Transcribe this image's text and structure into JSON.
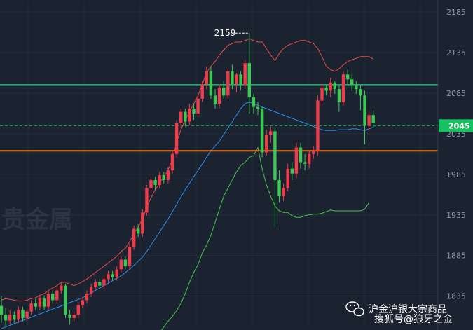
{
  "watermark": "贵金属",
  "wechat_account": "沪金沪银大宗商品",
  "sohu_account": "搜狐号@狼牙之金",
  "chart_data": {
    "type": "candlestick",
    "ylim": [
      1795,
      2198
    ],
    "yticks": [
      1835,
      1885,
      1935,
      1985,
      2035,
      2085,
      2135,
      2185
    ],
    "current_price": 2045,
    "current_price_label": "2045",
    "high_annotation": 2159,
    "high_annotation_label": "2159",
    "levels": [
      {
        "value": 2095,
        "color": "#4ee0a2"
      },
      {
        "value": 2014,
        "color": "#f07b1f"
      }
    ],
    "colors": {
      "up": "#ef3b4a",
      "down": "#3ec856",
      "mid": "#2b8ff0",
      "upper": "#e84a4a",
      "lower": "#4cc050",
      "tag": "#16c15f"
    },
    "candles": [
      [
        1823,
        1812,
        1835,
        1802
      ],
      [
        1812,
        1805,
        1820,
        1798
      ],
      [
        1805,
        1812,
        1818,
        1800
      ],
      [
        1812,
        1806,
        1816,
        1802
      ],
      [
        1806,
        1818,
        1822,
        1802
      ],
      [
        1818,
        1808,
        1822,
        1804
      ],
      [
        1808,
        1816,
        1820,
        1804
      ],
      [
        1816,
        1826,
        1830,
        1812
      ],
      [
        1826,
        1822,
        1832,
        1818
      ],
      [
        1822,
        1832,
        1836,
        1818
      ],
      [
        1832,
        1822,
        1836,
        1818
      ],
      [
        1822,
        1838,
        1842,
        1818
      ],
      [
        1838,
        1830,
        1842,
        1826
      ],
      [
        1830,
        1842,
        1846,
        1826
      ],
      [
        1842,
        1848,
        1852,
        1838
      ],
      [
        1848,
        1812,
        1850,
        1808
      ],
      [
        1812,
        1808,
        1818,
        1800
      ],
      [
        1808,
        1812,
        1816,
        1804
      ],
      [
        1812,
        1824,
        1828,
        1808
      ],
      [
        1824,
        1830,
        1834,
        1820
      ],
      [
        1830,
        1838,
        1842,
        1826
      ],
      [
        1838,
        1846,
        1850,
        1834
      ],
      [
        1846,
        1852,
        1856,
        1842
      ],
      [
        1852,
        1848,
        1856,
        1844
      ],
      [
        1848,
        1856,
        1860,
        1844
      ],
      [
        1856,
        1862,
        1866,
        1852
      ],
      [
        1862,
        1858,
        1866,
        1854
      ],
      [
        1858,
        1868,
        1872,
        1854
      ],
      [
        1868,
        1880,
        1884,
        1864
      ],
      [
        1880,
        1872,
        1884,
        1868
      ],
      [
        1872,
        1896,
        1900,
        1868
      ],
      [
        1896,
        1918,
        1922,
        1892
      ],
      [
        1918,
        1912,
        1924,
        1908
      ],
      [
        1912,
        1938,
        1942,
        1908
      ],
      [
        1938,
        1968,
        1972,
        1934
      ],
      [
        1968,
        1978,
        1982,
        1962
      ],
      [
        1978,
        1972,
        1982,
        1966
      ],
      [
        1972,
        1984,
        1988,
        1968
      ],
      [
        1984,
        1978,
        1988,
        1974
      ],
      [
        1978,
        1990,
        1994,
        1974
      ],
      [
        1990,
        2010,
        2015,
        1986
      ],
      [
        2010,
        2048,
        2052,
        2006
      ],
      [
        2048,
        2062,
        2066,
        2042
      ],
      [
        2062,
        2050,
        2066,
        2044
      ],
      [
        2050,
        2066,
        2072,
        2046
      ],
      [
        2066,
        2060,
        2072,
        2052
      ],
      [
        2060,
        2078,
        2082,
        2056
      ],
      [
        2078,
        2096,
        2100,
        2074
      ],
      [
        2096,
        2112,
        2118,
        2090
      ],
      [
        2112,
        2082,
        2118,
        2078
      ],
      [
        2082,
        2072,
        2090,
        2066
      ],
      [
        2072,
        2092,
        2096,
        2066
      ],
      [
        2092,
        2082,
        2100,
        2078
      ],
      [
        2082,
        2112,
        2116,
        2078
      ],
      [
        2112,
        2096,
        2120,
        2090
      ],
      [
        2096,
        2108,
        2110,
        2086
      ],
      [
        2108,
        2095,
        2112,
        2088
      ],
      [
        2095,
        2122,
        2126,
        2090
      ],
      [
        2122,
        2080,
        2159,
        2060
      ],
      [
        2080,
        2068,
        2084,
        2060
      ],
      [
        2068,
        2066,
        2074,
        2058
      ],
      [
        2066,
        2012,
        2068,
        2006
      ],
      [
        2012,
        2034,
        2040,
        2008
      ],
      [
        2034,
        2038,
        2044,
        2024
      ],
      [
        2038,
        1978,
        2042,
        1920
      ],
      [
        1978,
        1958,
        1990,
        1950
      ],
      [
        1958,
        1968,
        1974,
        1952
      ],
      [
        1968,
        1992,
        1998,
        1964
      ],
      [
        1992,
        1986,
        2000,
        1978
      ],
      [
        1986,
        2018,
        2024,
        1980
      ],
      [
        2018,
        2000,
        2024,
        1992
      ],
      [
        2000,
        1998,
        2010,
        1990
      ],
      [
        1998,
        2010,
        2014,
        1992
      ],
      [
        2010,
        2014,
        2020,
        2004
      ],
      [
        2014,
        2076,
        2082,
        2008
      ],
      [
        2076,
        2092,
        2096,
        2070
      ],
      [
        2092,
        2088,
        2096,
        2082
      ],
      [
        2088,
        2098,
        2104,
        2080
      ],
      [
        2098,
        2090,
        2100,
        2084
      ],
      [
        2090,
        2074,
        2094,
        2062
      ],
      [
        2074,
        2108,
        2112,
        2070
      ],
      [
        2108,
        2102,
        2114,
        2094
      ],
      [
        2102,
        2094,
        2108,
        2088
      ],
      [
        2094,
        2090,
        2100,
        2084
      ],
      [
        2090,
        2082,
        2094,
        2064
      ],
      [
        2082,
        2045,
        2088,
        2022
      ],
      [
        2045,
        2058,
        2062,
        2038
      ],
      [
        2058,
        2048,
        2064,
        2042
      ]
    ],
    "bb_upper": [
      1830,
      1832,
      1831,
      1830,
      1829,
      1829,
      1830,
      1832,
      1833,
      1836,
      1838,
      1842,
      1845,
      1848,
      1852,
      1852,
      1850,
      1848,
      1850,
      1853,
      1856,
      1860,
      1864,
      1868,
      1872,
      1876,
      1880,
      1884,
      1890,
      1894,
      1902,
      1912,
      1920,
      1930,
      1944,
      1956,
      1966,
      1974,
      1982,
      1990,
      2004,
      2024,
      2040,
      2052,
      2062,
      2072,
      2082,
      2096,
      2110,
      2118,
      2124,
      2132,
      2138,
      2144,
      2146,
      2148,
      2148,
      2150,
      2152,
      2150,
      2148,
      2148,
      2140,
      2132,
      2125,
      2134,
      2140,
      2144,
      2146,
      2148,
      2150,
      2150,
      2148,
      2146,
      2140,
      2130,
      2118,
      2114,
      2112,
      2115,
      2120,
      2124,
      2126,
      2128,
      2130,
      2130,
      2130,
      2127
    ],
    "bb_mid": [
      1795,
      1797,
      1799,
      1801,
      1803,
      1805,
      1807,
      1809,
      1811,
      1813,
      1815,
      1817,
      1819,
      1821,
      1823,
      1825,
      1827,
      1829,
      1831,
      1833,
      1836,
      1839,
      1842,
      1845,
      1848,
      1851,
      1854,
      1857,
      1860,
      1864,
      1868,
      1873,
      1878,
      1883,
      1890,
      1898,
      1906,
      1914,
      1922,
      1930,
      1939,
      1948,
      1957,
      1966,
      1974,
      1982,
      1990,
      1998,
      2006,
      2014,
      2020,
      2026,
      2034,
      2042,
      2050,
      2058,
      2066,
      2072,
      2074,
      2072,
      2070,
      2068,
      2066,
      2064,
      2062,
      2060,
      2058,
      2056,
      2054,
      2052,
      2050,
      2048,
      2046,
      2044,
      2042,
      2040,
      2039,
      2039,
      2039,
      2040,
      2040,
      2040,
      2041,
      2041,
      2040,
      2039,
      2041,
      2043
    ],
    "bb_lower": [
      null,
      null,
      null,
      null,
      null,
      null,
      null,
      null,
      null,
      null,
      null,
      null,
      null,
      null,
      null,
      null,
      null,
      null,
      null,
      null,
      null,
      null,
      null,
      null,
      null,
      null,
      null,
      null,
      null,
      null,
      null,
      null,
      null,
      null,
      null,
      1778,
      1783,
      1790,
      1797,
      1804,
      1810,
      1817,
      1826,
      1838,
      1852,
      1864,
      1874,
      1888,
      1898,
      1910,
      1926,
      1942,
      1958,
      1968,
      1978,
      1988,
      1996,
      2000,
      2006,
      2008,
      2018,
      1992,
      1972,
      1958,
      1946,
      1940,
      1938,
      1938,
      1934,
      1932,
      1932,
      1934,
      1935,
      1936,
      1936,
      1937,
      1939,
      1941,
      1940,
      1940,
      1940,
      1940,
      1940,
      1940,
      1940,
      1942,
      1950,
      null
    ]
  }
}
